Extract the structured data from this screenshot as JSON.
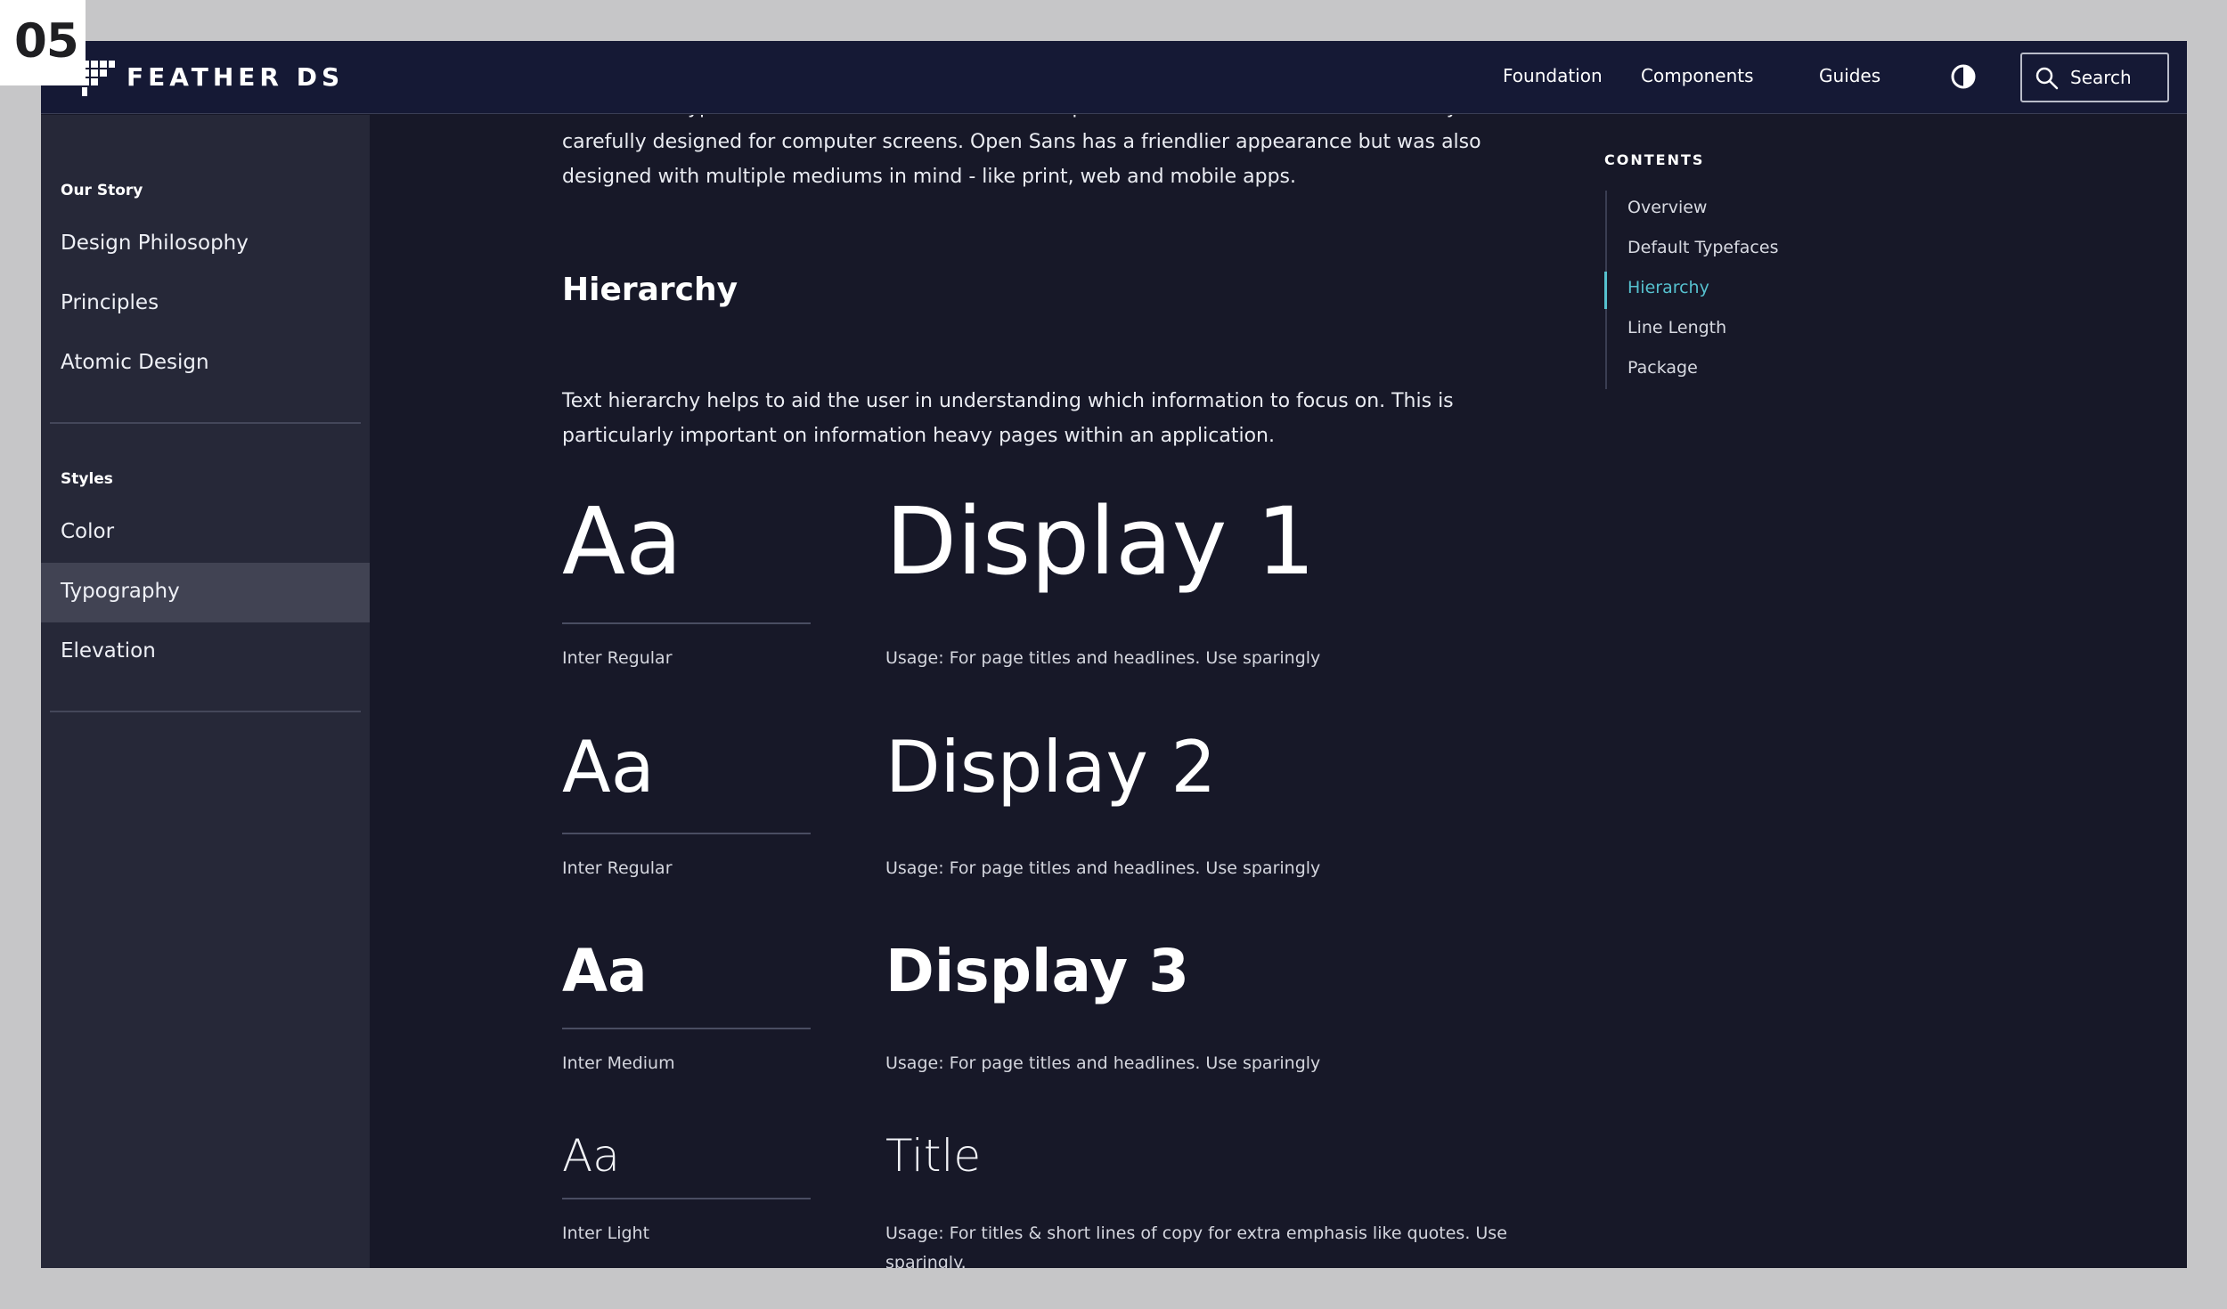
{
  "badge": "05",
  "header": {
    "brand": "FEATHER DS",
    "nav": [
      "Foundation",
      "Components",
      "Guides"
    ],
    "search_label": "Search"
  },
  "sidebar": {
    "groups": [
      {
        "title": "Our Story",
        "items": [
          "Design Philosophy",
          "Principles",
          "Atomic Design"
        ]
      },
      {
        "title": "Styles",
        "items": [
          "Color",
          "Typography",
          "Elevation"
        ]
      }
    ],
    "active_item": "Typography"
  },
  "content": {
    "intro": "The default typefaces for FeatherDS are Inter and Open Sans. Inter is a variable font family carefully designed for computer screens. Open Sans has a friendlier appearance but was also designed with multiple mediums in mind - like print, web and mobile apps.",
    "hierarchy_heading": "Hierarchy",
    "hierarchy_text": "Text hierarchy helps to aid the user in understanding which information to focus on. This is particularly important on information heavy pages within an application.",
    "type_styles": [
      {
        "sample": "Aa",
        "name": "Display 1",
        "font": "Inter Regular",
        "usage": "Usage: For page titles and headlines. Use sparingly"
      },
      {
        "sample": "Aa",
        "name": "Display 2",
        "font": "Inter Regular",
        "usage": "Usage: For page titles and headlines. Use sparingly"
      },
      {
        "sample": "Aa",
        "name": "Display 3",
        "font": "Inter Medium",
        "usage": "Usage: For page titles and headlines. Use sparingly"
      },
      {
        "sample": "Aa",
        "name": "Title",
        "font": "Inter Light",
        "usage": "Usage: For titles & short lines of copy for extra emphasis like quotes. Use sparingly."
      }
    ]
  },
  "toc": {
    "title": "CONTENTS",
    "items": [
      "Overview",
      "Default Typefaces",
      "Hierarchy",
      "Line Length",
      "Package"
    ],
    "active": "Hierarchy"
  },
  "colors": {
    "background": "#171828",
    "topbar": "#151935",
    "sidebar": "#262838",
    "sidebar_active": "#414353",
    "accent": "#56c1cf"
  },
  "icons": [
    "feather-logo-icon",
    "theme-toggle-icon",
    "search-icon"
  ]
}
